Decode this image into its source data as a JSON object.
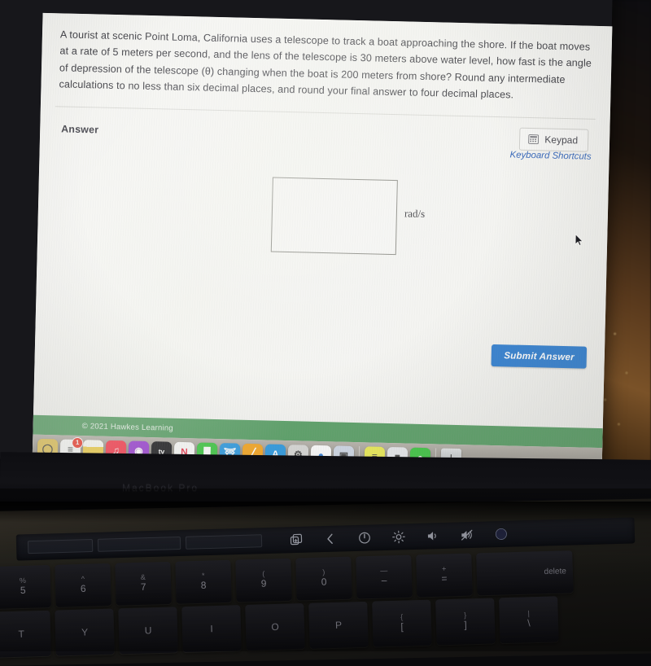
{
  "question": {
    "text": "A tourist at scenic Point Loma, California uses a telescope to track a boat approaching the shore. If the boat moves at a rate of 5 meters per second, and the lens of the telescope is 30 meters above water level, how fast is the angle of depression of the telescope (θ) changing when the boat is 200 meters from shore? Round any intermediate calculations to no less than six decimal places, and round your final answer to four decimal places."
  },
  "answer_section": {
    "label": "Answer",
    "keypad_button": "Keypad",
    "keyboard_shortcuts_link": "Keyboard Shortcuts",
    "input_value": "",
    "input_placeholder": "",
    "unit": "rad/s",
    "submit_button": "Submit Answer"
  },
  "footer": {
    "copyright": "© 2021 Hawkes Learning",
    "bar_color": "#599f66"
  },
  "colors": {
    "submit_blue": "#2f7ed1",
    "link_blue": "#2f62b8",
    "page_bg": "#f4f4f1"
  },
  "dock": {
    "items": [
      {
        "name": "contacts",
        "label": "Contacts",
        "color": "#e2c35a",
        "glyph": "◯",
        "badge": "",
        "running": false
      },
      {
        "name": "reminders",
        "label": "Reminders",
        "color": "#f7f7f5",
        "glyph": "≡",
        "badge": "1",
        "running": false
      },
      {
        "name": "notes",
        "label": "Notes",
        "color": "#f2d14b",
        "glyph": "",
        "badge": "",
        "running": false
      },
      {
        "name": "music",
        "label": "Music",
        "color": "#fa3b4e",
        "glyph": "♫",
        "badge": "",
        "running": false
      },
      {
        "name": "podcasts",
        "label": "Podcasts",
        "color": "#9b3fd4",
        "glyph": "◉",
        "badge": "",
        "running": false
      },
      {
        "name": "apple-tv",
        "label": "Apple TV",
        "color": "#1b1b1f",
        "glyph": "tv",
        "badge": "",
        "running": false
      },
      {
        "name": "news",
        "label": "News",
        "color": "#fbfbfa",
        "glyph": "N",
        "badge": "",
        "running": false
      },
      {
        "name": "numbers",
        "label": "Numbers",
        "color": "#3fc744",
        "glyph": "█",
        "badge": "",
        "running": false
      },
      {
        "name": "keynote",
        "label": "Keynote",
        "color": "#2f9ae0",
        "glyph": "⛩",
        "badge": "",
        "running": false
      },
      {
        "name": "pages",
        "label": "Pages",
        "color": "#f5a623",
        "glyph": "╱",
        "badge": "",
        "running": false
      },
      {
        "name": "app-store",
        "label": "App Store",
        "color": "#2f9ae0",
        "glyph": "A",
        "badge": "",
        "running": false
      },
      {
        "name": "system-preferences",
        "label": "System Preferences",
        "color": "#d8d8d6",
        "glyph": "⚙",
        "badge": "",
        "running": false
      },
      {
        "name": "chrome",
        "label": "Google Chrome",
        "color": "#fdfdfd",
        "glyph": "●",
        "badge": "",
        "running": true
      },
      {
        "name": "preview",
        "label": "Preview",
        "color": "#cfd8e6",
        "glyph": "▣",
        "badge": "",
        "running": false
      },
      {
        "name": "separator",
        "label": "",
        "color": "",
        "glyph": "",
        "badge": "",
        "running": false
      },
      {
        "name": "stickies",
        "label": "Stickies",
        "color": "#ecec55",
        "glyph": "≡",
        "badge": "",
        "running": true
      },
      {
        "name": "roblox",
        "label": "Roblox",
        "color": "#e8eaee",
        "glyph": "■",
        "badge": "",
        "running": false
      },
      {
        "name": "find-my",
        "label": "Find My",
        "color": "#3fc744",
        "glyph": "●",
        "badge": "",
        "running": false
      },
      {
        "name": "separator2",
        "label": "",
        "color": "",
        "glyph": "",
        "badge": "",
        "running": false
      },
      {
        "name": "trash",
        "label": "Trash",
        "color": "#c9ccce",
        "glyph": "ᴵ",
        "badge": "",
        "running": false
      }
    ]
  },
  "laptop": {
    "brand": "MacBook Pro",
    "touchbar_icons": [
      "new-tab-icon",
      "chevron-left-icon",
      "power-icon",
      "brightness-icon",
      "volume-icon",
      "mute-icon",
      "siri-icon"
    ],
    "keyboard": {
      "number_row": [
        {
          "upper": "%",
          "lower": "5"
        },
        {
          "upper": "^",
          "lower": "6"
        },
        {
          "upper": "&",
          "lower": "7"
        },
        {
          "upper": "*",
          "lower": "8"
        },
        {
          "upper": "(",
          "lower": "9"
        },
        {
          "upper": ")",
          "lower": "0"
        },
        {
          "upper": "—",
          "lower": "–"
        },
        {
          "upper": "+",
          "lower": "="
        }
      ],
      "delete_key": "delete",
      "letter_row": [
        {
          "upper": "",
          "lower": "T"
        },
        {
          "upper": "",
          "lower": "Y"
        },
        {
          "upper": "",
          "lower": "U"
        },
        {
          "upper": "",
          "lower": "I"
        },
        {
          "upper": "",
          "lower": "O"
        },
        {
          "upper": "",
          "lower": "P"
        },
        {
          "upper": "{",
          "lower": "["
        },
        {
          "upper": "}",
          "lower": "]"
        },
        {
          "upper": "|",
          "lower": "\\"
        }
      ]
    }
  }
}
